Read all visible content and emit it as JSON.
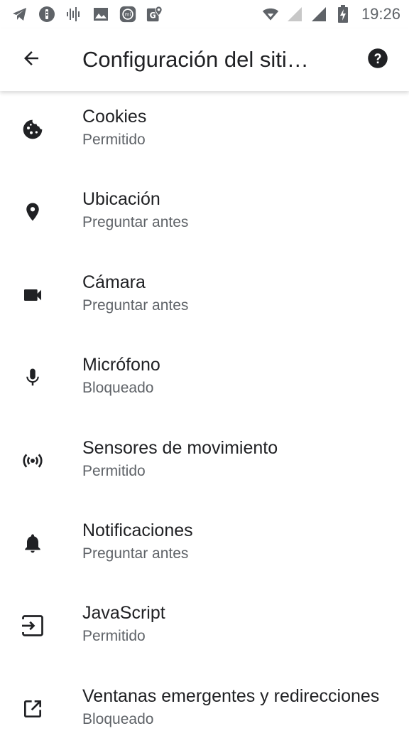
{
  "status_bar": {
    "time": "19:26",
    "icons": [
      "telegram-icon",
      "shield-badge-icon",
      "audio-wave-icon",
      "image-icon",
      "mi-icon",
      "maps-icon",
      "wifi-icon",
      "signal-weak-icon",
      "signal-icon",
      "battery-charging-icon"
    ]
  },
  "app_bar": {
    "title": "Configuración del siti…",
    "back_icon": "arrow-back-icon",
    "help_icon": "help-icon"
  },
  "settings": [
    {
      "title": "Cookies",
      "status": "Permitido",
      "icon": "cookie-icon"
    },
    {
      "title": "Ubicación",
      "status": "Preguntar antes",
      "icon": "location-icon"
    },
    {
      "title": "Cámara",
      "status": "Preguntar antes",
      "icon": "camera-icon"
    },
    {
      "title": "Micrófono",
      "status": "Bloqueado",
      "icon": "microphone-icon"
    },
    {
      "title": "Sensores de movimiento",
      "status": "Permitido",
      "icon": "motion-sensor-icon"
    },
    {
      "title": "Notificaciones",
      "status": "Preguntar antes",
      "icon": "bell-icon"
    },
    {
      "title": "JavaScript",
      "status": "Permitido",
      "icon": "javascript-icon"
    },
    {
      "title": "Ventanas emergentes y redirecciones",
      "status": "Bloqueado",
      "icon": "popup-icon"
    }
  ],
  "colors": {
    "primary_text": "#202124",
    "secondary_text": "#5f6368",
    "icon": "#202124",
    "status_icon": "#5f6368"
  }
}
